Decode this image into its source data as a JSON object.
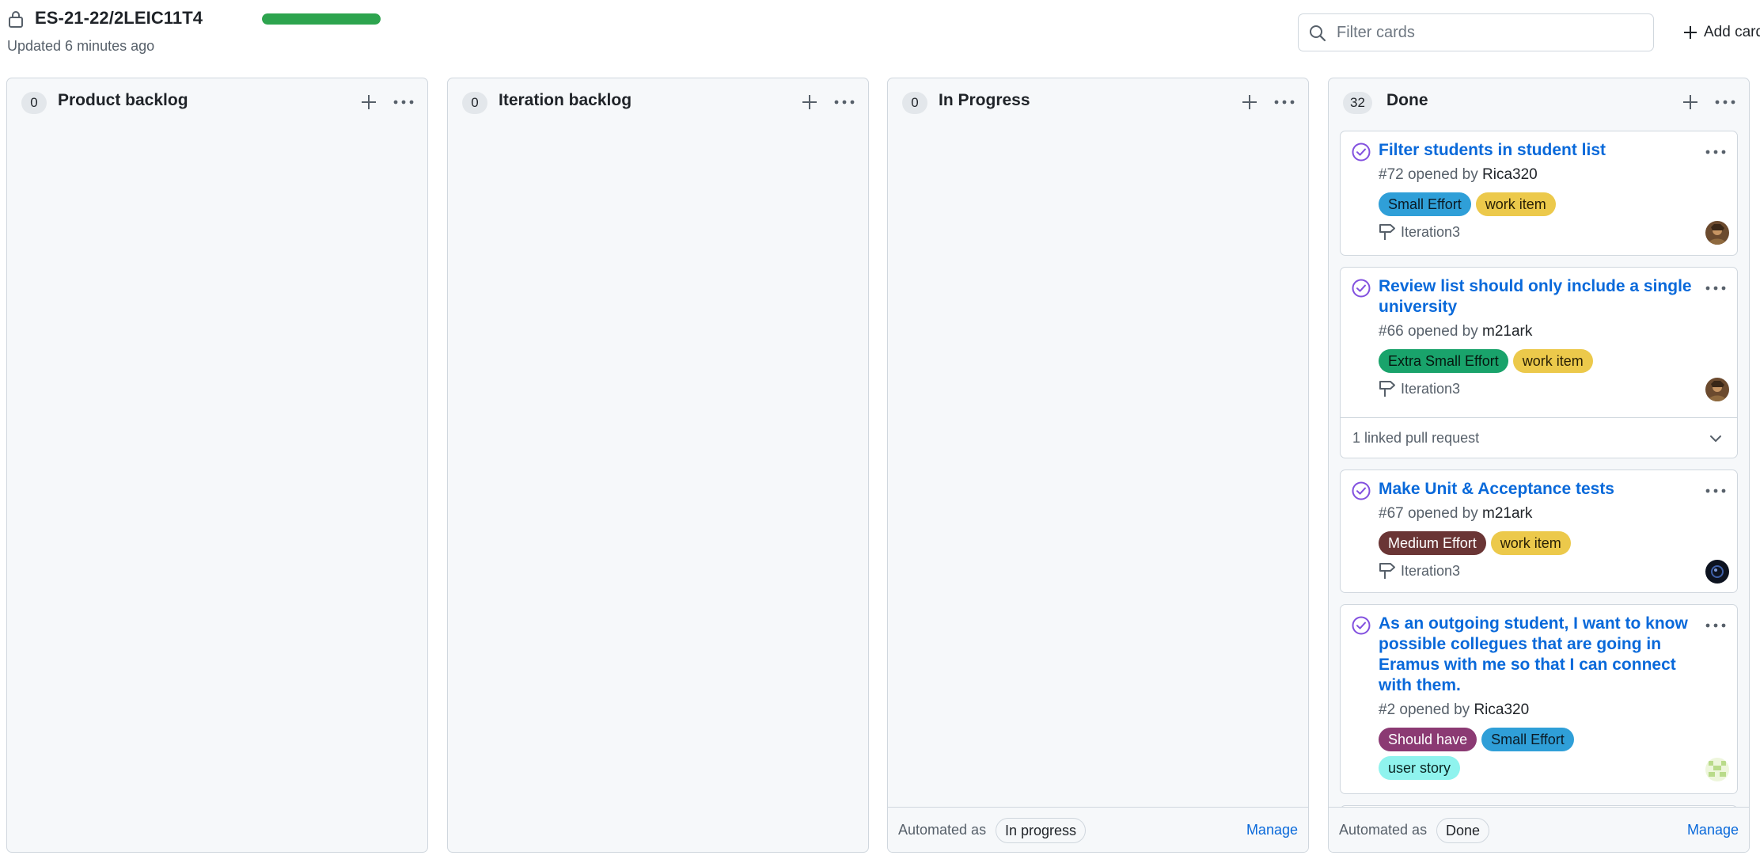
{
  "board": {
    "title": "ES-21-22/2LEIC11T4",
    "updated": "Updated 6 minutes ago",
    "progress_fraction": 1.0,
    "progress_color": "#2da44e"
  },
  "filter": {
    "placeholder": "Filter cards"
  },
  "add_cards_label": "Add cards",
  "columns": [
    {
      "count": "0",
      "title": "Product backlog"
    },
    {
      "count": "0",
      "title": "Iteration backlog"
    },
    {
      "count": "0",
      "title": "In Progress",
      "automation": {
        "label": "Automated as",
        "value": "In progress",
        "manage": "Manage"
      }
    },
    {
      "count": "32",
      "title": "Done",
      "automation": {
        "label": "Automated as",
        "value": "Done",
        "manage": "Manage"
      },
      "cards": [
        {
          "title": "Filter students in student list",
          "number": "#72",
          "opened_by": "opened by",
          "user": "Rica320",
          "labels": [
            {
              "text": "Small Effort",
              "bg": "#2f9fd8",
              "fg": "#0b1b26"
            },
            {
              "text": "work item",
              "bg": "#ecc94b",
              "fg": "#2a2106"
            }
          ],
          "milestone": "Iteration3"
        },
        {
          "title": "Review list should only include a single university",
          "number": "#66",
          "opened_by": "opened by",
          "user": "m21ark",
          "labels": [
            {
              "text": "Extra Small Effort",
              "bg": "#19a36b",
              "fg": "#06170f"
            },
            {
              "text": "work item",
              "bg": "#ecc94b",
              "fg": "#2a2106"
            }
          ],
          "milestone": "Iteration3",
          "linked": "1 linked pull request"
        },
        {
          "title": "Make Unit & Acceptance tests",
          "number": "#67",
          "opened_by": "opened by",
          "user": "m21ark",
          "labels": [
            {
              "text": "Medium Effort",
              "bg": "#6a3535",
              "fg": "#ffffff"
            },
            {
              "text": "work item",
              "bg": "#ecc94b",
              "fg": "#2a2106"
            }
          ],
          "milestone": "Iteration3"
        },
        {
          "title": "As an outgoing student, I want to know possible collegues that are going in Eramus with me so that I can connect with them.",
          "number": "#2",
          "opened_by": "opened by",
          "user": "Rica320",
          "labels": [
            {
              "text": "Should have",
              "bg": "#8b3a73",
              "fg": "#ffffff"
            },
            {
              "text": "Small Effort",
              "bg": "#2f9fd8",
              "fg": "#0b1b26"
            },
            {
              "text": "user story",
              "bg": "#8ff3ee",
              "fg": "#0b2624"
            }
          ]
        }
      ]
    }
  ]
}
